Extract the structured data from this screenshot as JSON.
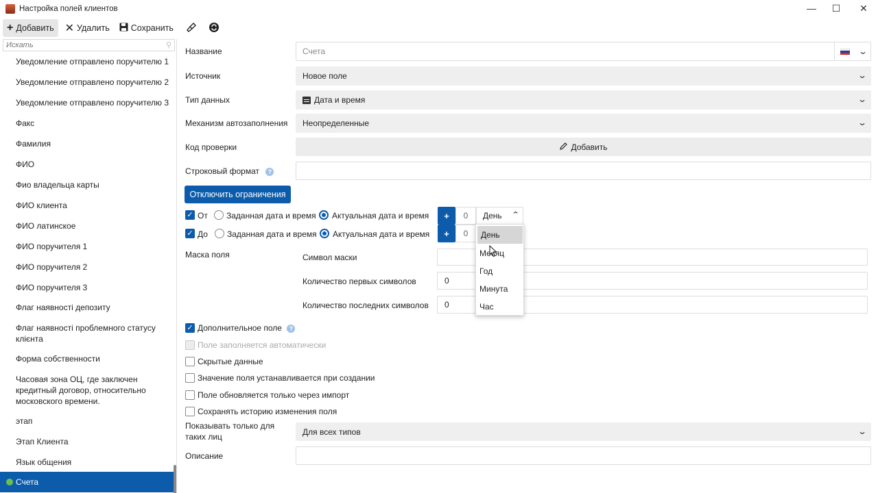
{
  "window": {
    "title": "Настройка полей клиентов"
  },
  "toolbar": {
    "add": "Добавить",
    "delete": "Удалить",
    "save": "Сохранить"
  },
  "sidebar": {
    "search_placeholder": "Искать",
    "items": [
      "Уведомление отправлено поручителю 1",
      "Уведомление отправлено поручителю 2",
      "Уведомление отправлено поручителю 3",
      "Факс",
      "Фамилия",
      "ФИО",
      "Фио владельца карты",
      "ФИО клиента",
      "ФИО латинское",
      "ФИО поручителя 1",
      "ФИО поручителя 2",
      "ФИО поручителя 3",
      "Флаг наявності депозиту",
      "Флаг наявності проблемного статусу клієнта",
      "Форма собственности",
      "Часовая зона ОЦ, где заключен кредитный договор, относительно московского времени.",
      "этап",
      "Этап Клиента",
      "Язык общения",
      "Счета"
    ]
  },
  "form": {
    "name_label": "Название",
    "name_value": "Счета",
    "source_label": "Источник",
    "source_value": "Новое поле",
    "type_label": "Тип данных",
    "type_value": "Дата и время",
    "autofill_label": "Механизм автозаполнения",
    "autofill_value": "Неопределенные",
    "check_label": "Код проверки",
    "check_button": "Добавить",
    "format_label": "Строковый формат",
    "disable_limits": "Отключить ограничения",
    "from_label": "От",
    "to_label": "До",
    "given_dt": "Заданная дата и время",
    "actual_dt": "Актуальная дата и время",
    "plus": "+",
    "from_num": "0",
    "to_num": "0",
    "unit_value": "День",
    "mask_label": "Маска поля",
    "mask_symbol_label": "Символ маски",
    "first_count_label": "Количество первых символов",
    "first_count_value": "0",
    "last_count_label": "Количество последних символов",
    "last_count_value": "0",
    "extra_field": "Дополнительное поле",
    "auto_filled": "Поле заполняется автоматически",
    "hidden_data": "Скрытые данные",
    "set_on_create": "Значение поля устанавливается при создании",
    "import_only": "Поле обновляется только через импорт",
    "keep_history": "Сохранять историю изменения поля",
    "show_for_label": "Показывать только для таких лиц",
    "show_for_value": "Для всех типов",
    "description_label": "Описание"
  },
  "dropdown": {
    "options": [
      "День",
      "Месяц",
      "Год",
      "Минута",
      "Час"
    ],
    "highlighted": "День"
  },
  "colors": {
    "accent": "#0d5cab",
    "selected_dot": "#6cc04a"
  }
}
